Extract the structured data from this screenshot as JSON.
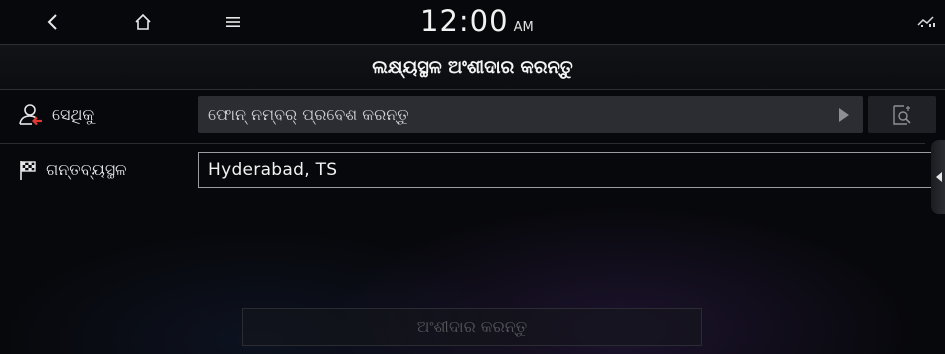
{
  "status_bar": {
    "time": "12:00",
    "ampm": "AM",
    "icons": [
      "back-icon",
      "home-icon",
      "menu-icon",
      "signal-icon"
    ]
  },
  "header": {
    "title": "ଲକ୍ଷ୍ୟସ୍ଥଳ ଅଂଶୀଦାର କରନ୍ତୁ"
  },
  "form": {
    "to_label": "ସେଥିକୁ",
    "to_icon": "contact-person-icon",
    "phone_placeholder": "ଫୋନ୍ ନମ୍ବର୍ ପ୍ରବେଶ କରନ୍ତୁ",
    "contacts_icon": "contacts-search-icon",
    "destination_label": "ଗନ୍ତବ୍ୟସ୍ଥଳ",
    "destination_icon": "checkered-flag-icon",
    "destination_value": "Hyderabad, TS"
  },
  "actions": {
    "share_label": "ଅଂଶୀଦାର କରନ୍ତୁ",
    "share_enabled": false
  },
  "colors": {
    "background": "#07080b",
    "input_fill": "#2b2d33",
    "accent_red": "#e23a33",
    "disabled_text": "#55575d"
  }
}
